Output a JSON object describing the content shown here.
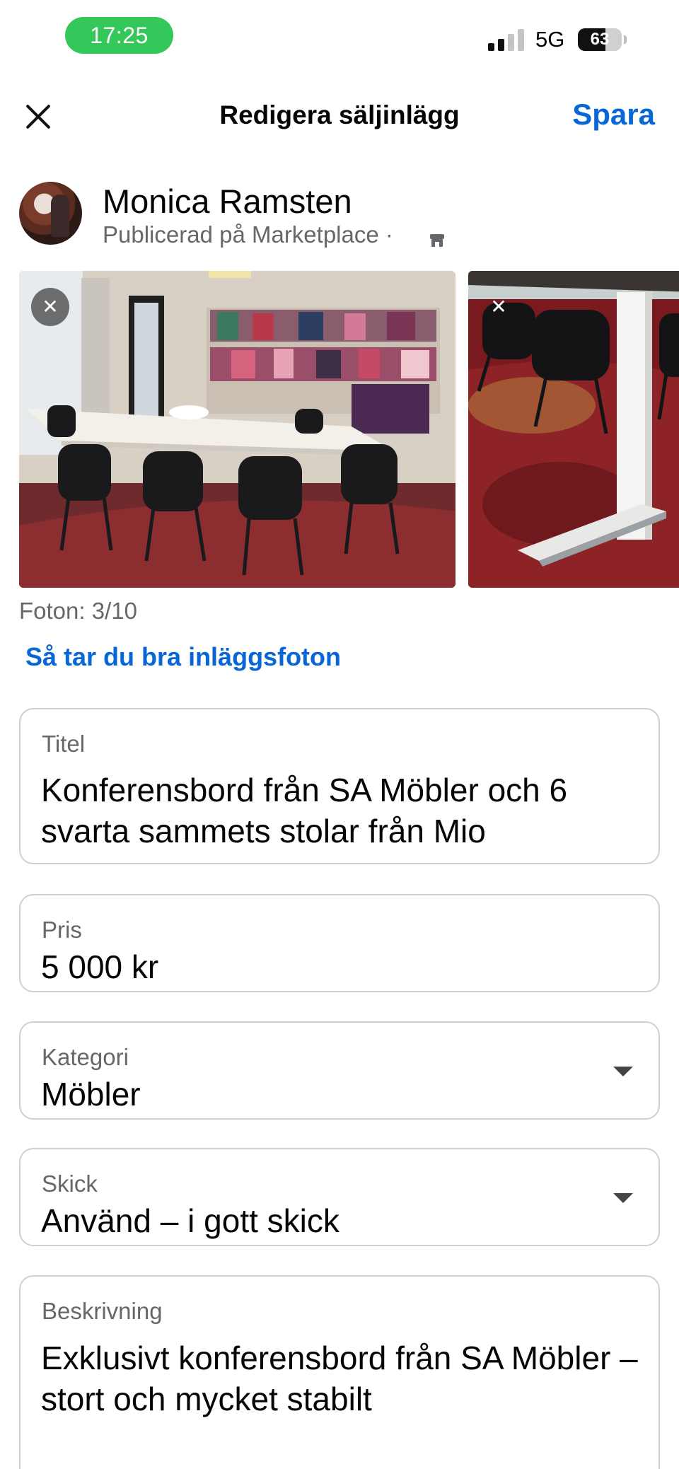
{
  "status_bar": {
    "time": "17:25",
    "network": "5G",
    "battery": "63",
    "battery_level": 0.63,
    "signal_bars": 2
  },
  "header": {
    "title": "Redigera säljinlägg",
    "save_label": "Spara",
    "close_icon": "close-icon"
  },
  "profile": {
    "name": "Monica Ramsten",
    "subtitle": "Publicerad på Marketplace ·",
    "subtitle_icon": "shop-icon"
  },
  "photos": {
    "items": [
      {
        "alt": "photo-1",
        "remove_icon": "close-icon"
      },
      {
        "alt": "photo-2",
        "remove_icon": "close-icon"
      }
    ],
    "count": "Foton: 3/10",
    "tips_link": "Så tar du bra inläggsfoton"
  },
  "form": {
    "title": {
      "label": "Titel",
      "value": "Konferensbord från SA Möbler och 6 svarta sammets stolar från Mio"
    },
    "price": {
      "label": "Pris",
      "value": "5 000 kr"
    },
    "category": {
      "label": "Kategori",
      "value": "Möbler"
    },
    "condition": {
      "label": "Skick",
      "value": "Använd – i gott skick"
    },
    "description": {
      "label": "Beskrivning",
      "value": "Exklusivt konferensbord från SA Möbler – stort och mycket stabilt"
    }
  },
  "colors": {
    "accent": "#0866d6",
    "time_pill": "#34c759",
    "secondary_text": "#65676b",
    "field_border": "#ced0d4"
  }
}
